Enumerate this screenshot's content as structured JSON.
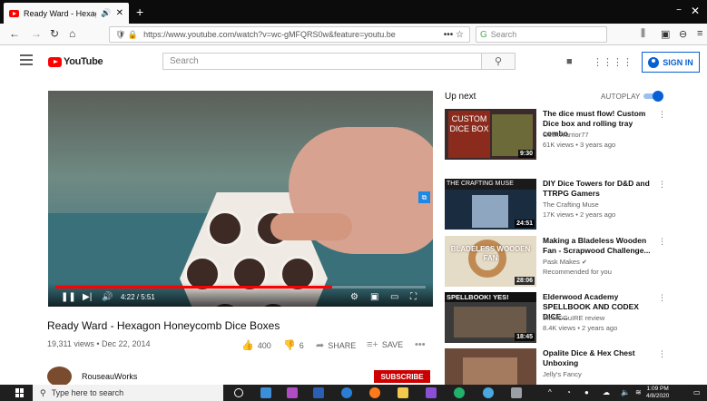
{
  "browser": {
    "tab_title": "Ready Ward - Hexagon Hon",
    "url": "https://www.youtube.com/watch?v=wc-gMFQRS0w&feature=youtu.be",
    "search_placeholder": "Search",
    "new_tab": "+",
    "minimize": "−",
    "close": "✕"
  },
  "youtube": {
    "logo_text": "YouTube",
    "search_placeholder": "Search",
    "sign_in": "SIGN IN"
  },
  "player": {
    "current_time": "4:22 / 5:51",
    "progress": 0.747
  },
  "video": {
    "title": "Ready Ward - Hexagon Honeycomb Dice Boxes",
    "meta": "19,311 views • Dec 22, 2014",
    "likes": "400",
    "dislikes": "6",
    "share": "SHARE",
    "save": "SAVE",
    "channel": "RouseauWorks",
    "subscribe": "SUBSCRIBE"
  },
  "sidebar": {
    "up_next": "Up next",
    "autoplay": "AUTOPLAY",
    "autoplay_on": true,
    "items": [
      {
        "title": "The dice must flow! Custom Dice box and rolling tray combo",
        "channel": "GeekWarrior77",
        "views": "61K views • 3 years ago",
        "duration": "9:30",
        "thumb_text": "CUSTOM DICE BOX"
      },
      {
        "title": "DIY Dice Towers for D&D and TTRPG Gamers",
        "channel": "The Crafting Muse",
        "views": "17K views • 2 years ago",
        "duration": "24:51",
        "thumb_text": "THE CRAFTING MUSE"
      },
      {
        "title": "Making a Bladeless Wooden Fan - Scrapwood Challenge...",
        "channel": "Pask Makes",
        "views": "Recommended for you",
        "duration": "28:06",
        "thumb_text": "BLADELESS WOODEN FAN"
      },
      {
        "title": "Elderwood Academy SPELLBOOK AND CODEX DICE...",
        "channel": "theMCGuIRE review",
        "views": "8.4K views • 2 years ago",
        "duration": "18:45",
        "thumb_text": "SPELLBOOK! YES!"
      },
      {
        "title": "Opalite Dice & Hex Chest Unboxing",
        "channel": "Jelly's Fancy",
        "views": "",
        "duration": "",
        "thumb_text": ""
      }
    ]
  },
  "taskbar": {
    "search_placeholder": "Type here to search",
    "time": "1:09 PM",
    "date": "4/8/2020"
  }
}
